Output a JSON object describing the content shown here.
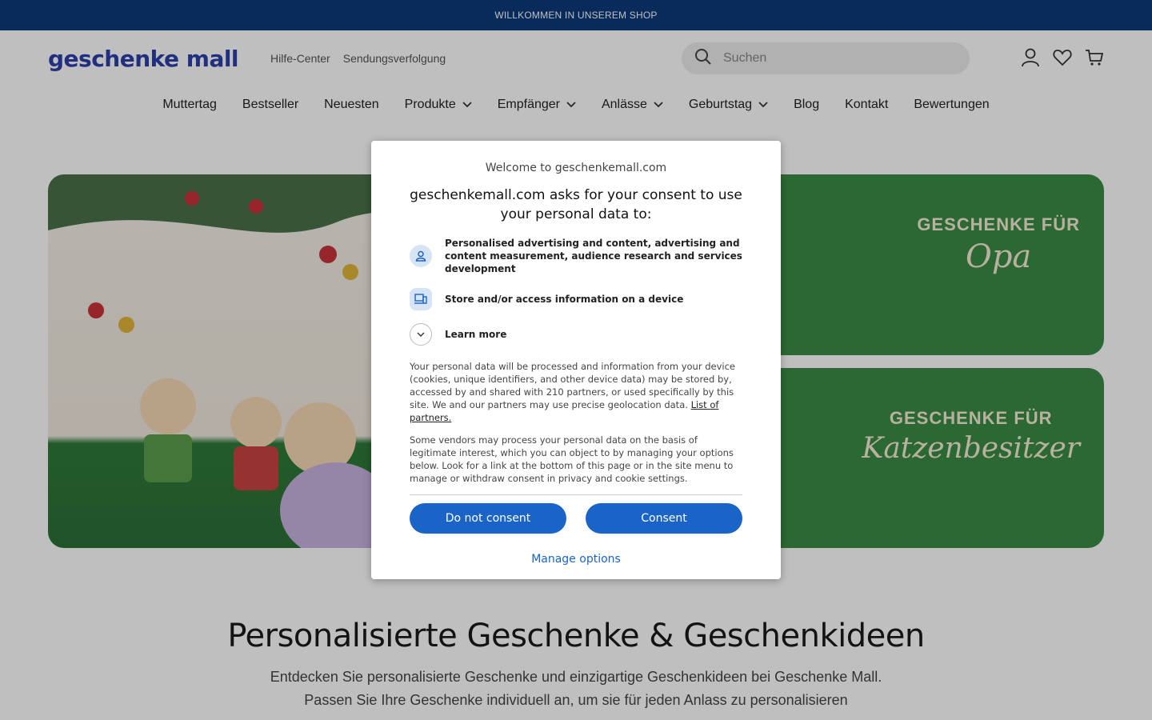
{
  "topbar": {
    "text": "WILLKOMMEN IN UNSEREM SHOP"
  },
  "header": {
    "logo": "geschenke mall",
    "links": [
      "Hilfe-Center",
      "Sendungsverfolgung"
    ],
    "search_placeholder": "Suchen",
    "icons": [
      "user-icon",
      "heart-icon",
      "cart-icon"
    ]
  },
  "nav": {
    "items": [
      {
        "label": "Muttertag",
        "dropdown": false
      },
      {
        "label": "Bestseller",
        "dropdown": false
      },
      {
        "label": "Neuesten",
        "dropdown": false
      },
      {
        "label": "Produkte",
        "dropdown": true
      },
      {
        "label": "Empfänger",
        "dropdown": true
      },
      {
        "label": "Anlässe",
        "dropdown": true
      },
      {
        "label": "Geburtstag",
        "dropdown": true
      },
      {
        "label": "Blog",
        "dropdown": false
      },
      {
        "label": "Kontakt",
        "dropdown": false
      },
      {
        "label": "Bewertungen",
        "dropdown": false
      }
    ]
  },
  "banners": {
    "right1": {
      "small": "GESCHENKE FÜR",
      "big": "Opa"
    },
    "right2": {
      "small": "GESCHENKE FÜR",
      "big": "Katzenbesitzer"
    }
  },
  "intro": {
    "title": "Personalisierte Geschenke & Geschenkideen",
    "line1": "Entdecken Sie personalisierte Geschenke und einzigartige Geschenkideen bei Geschenke Mall.",
    "line2": "Passen Sie Ihre Geschenke individuell an, um sie für jeden Anlass zu personalisieren"
  },
  "consent": {
    "welcome": "Welcome to geschenkemall.com",
    "title": "geschenkemall.com asks for your consent to use your personal data to:",
    "purpose1": "Personalised advertising and content, advertising and content measurement, audience research and services development",
    "purpose2": "Store and/or access information on a device",
    "learn_more": "Learn more",
    "para1": "Your personal data will be processed and information from your device (cookies, unique identifiers, and other device data) may be stored by, accessed by and shared with 210 partners, or used specifically by this site. We and our partners may use precise geolocation data.",
    "partners_link": "List of partners.",
    "para2": "Some vendors may process your personal data on the basis of legitimate interest, which you can object to by managing your options below. Look for a link at the bottom of this page or in the site menu to manage or withdraw consent in privacy and cookie settings.",
    "btn_reject": "Do not consent",
    "btn_accept": "Consent",
    "manage": "Manage options"
  },
  "colors": {
    "topbar": "#0d3a7a",
    "logo": "#2b3fa8",
    "consent_button": "#1a64c8",
    "banner_green": "#3b8b46"
  }
}
